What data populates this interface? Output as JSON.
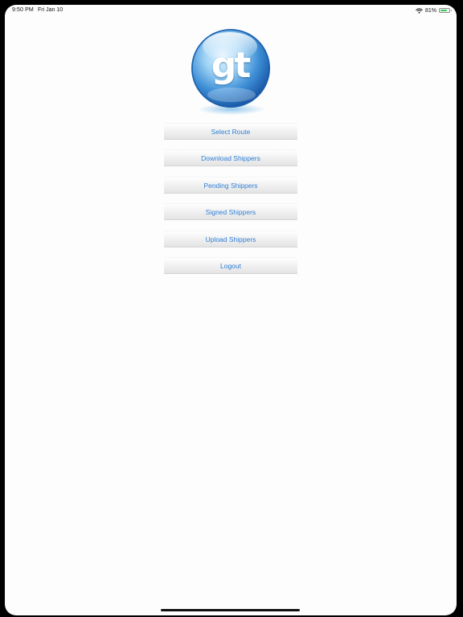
{
  "status_bar": {
    "time": "9:50 PM",
    "date": "Fri Jan 10",
    "battery_percent_label": "81%",
    "battery_level": 0.81,
    "wifi_icon": "wifi-icon",
    "battery_icon": "battery-icon"
  },
  "logo": {
    "text": "gt",
    "icon": "gt-globe-logo"
  },
  "menu": {
    "items": [
      {
        "label": "Select Route"
      },
      {
        "label": "Download Shippers"
      },
      {
        "label": "Pending Shippers"
      },
      {
        "label": "Signed Shippers"
      },
      {
        "label": "Upload Shippers"
      },
      {
        "label": "Logout"
      }
    ]
  },
  "colors": {
    "button_text": "#2f7fd6",
    "background": "#fdfdfd",
    "battery_fill": "#34c759"
  }
}
